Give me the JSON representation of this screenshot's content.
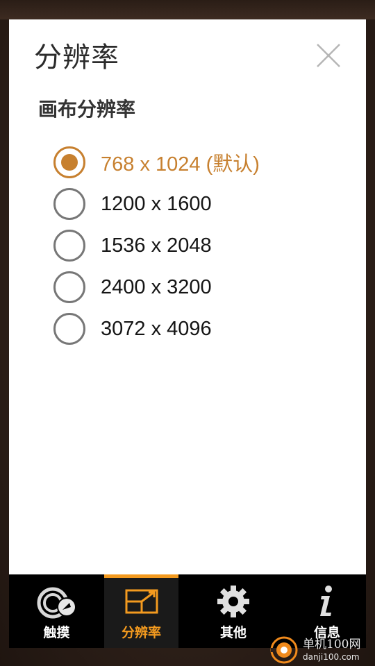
{
  "dialog": {
    "title": "分辨率",
    "section_title": "画布分辨率",
    "options": [
      {
        "label": "768 x 1024 (默认)",
        "selected": true
      },
      {
        "label": "1200 x 1600",
        "selected": false
      },
      {
        "label": "1536 x 2048",
        "selected": false
      },
      {
        "label": "2400 x 3200",
        "selected": false
      },
      {
        "label": "3072 x 4096",
        "selected": false
      }
    ]
  },
  "tabs": [
    {
      "label": "触摸",
      "icon": "touch-icon",
      "active": false
    },
    {
      "label": "分辨率",
      "icon": "resolution-icon",
      "active": true
    },
    {
      "label": "其他",
      "icon": "gear-icon",
      "active": false
    },
    {
      "label": "信息",
      "icon": "info-icon",
      "active": false
    }
  ],
  "watermark": {
    "site_name": "单机100网",
    "site_url": "danji100.com"
  },
  "colors": {
    "accent": "#c7802f",
    "tab_active": "#f39a1f",
    "tabbar_bg": "#000000",
    "dialog_bg": "#ffffff"
  }
}
